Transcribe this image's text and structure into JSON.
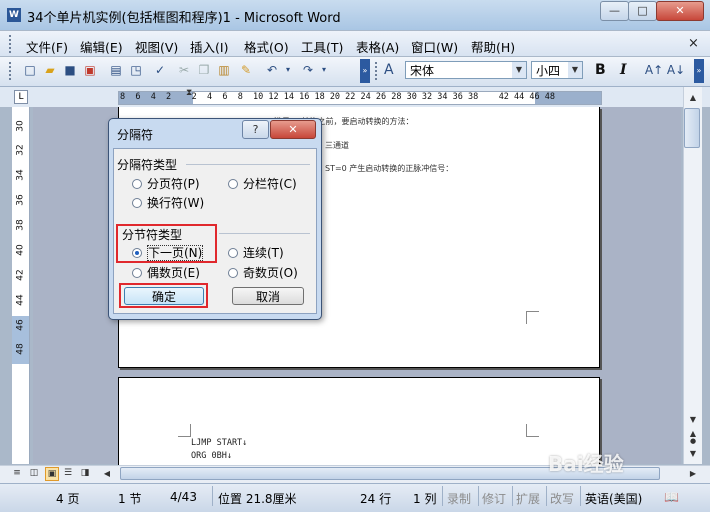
{
  "window": {
    "title": "34个单片机实例(包括框图和程序)1 - Microsoft Word",
    "app_icon": "W",
    "minimize": "—",
    "maximize": "□",
    "close": "✕"
  },
  "menu": [
    "文件(F)",
    "编辑(E)",
    "视图(V)",
    "插入(I)",
    "格式(O)",
    "工具(T)",
    "表格(A)",
    "窗口(W)",
    "帮助(H)"
  ],
  "doc_close": "×",
  "toolbar": {
    "style_label": "A",
    "font": "宋体",
    "size": "小四",
    "bold": "B",
    "italic": "I"
  },
  "ruler": {
    "numbers": "8  6  4  2    2  4  6  8  10 12 14 16 18 20 22 24 26 28 30 32 34 36 38    42 44 46 48",
    "vertical": [
      "30",
      "32",
      "34",
      "36",
      "38",
      "40",
      "42",
      "44",
      "46",
      "48"
    ]
  },
  "document": {
    "page1_lines": [
      "(3)  满足AD转换之前，要启动转换的方法：",
      "三通道",
      "ST=0 产生启动转换的正脉冲信号："
    ],
    "page2_lines": [
      "LJMP START↓",
      "ORG 0BH↓"
    ]
  },
  "dialog": {
    "title": "分隔符",
    "help": "?",
    "close": "✕",
    "break_types_label": "分隔符类型",
    "break_options": [
      {
        "label": "分页符(P)",
        "checked": false
      },
      {
        "label": "分栏符(C)",
        "checked": false
      },
      {
        "label": "换行符(W)",
        "checked": false
      }
    ],
    "section_types_label": "分节符类型",
    "section_options": [
      {
        "label": "下一页(N)",
        "checked": true
      },
      {
        "label": "连续(T)",
        "checked": false
      },
      {
        "label": "偶数页(E)",
        "checked": false
      },
      {
        "label": "奇数页(O)",
        "checked": false
      }
    ],
    "ok": "确定",
    "cancel": "取消",
    "highlight_color": "#e0282d"
  },
  "status": {
    "page": "4 页",
    "section": "1 节",
    "pages": "4/43",
    "position": "位置 21.8厘米",
    "line": "24 行",
    "column": "1 列",
    "rec": "录制",
    "trk": "修订",
    "ext": "扩展",
    "ovr": "改写",
    "language": "英语(美国)"
  },
  "watermark": "Bai经验"
}
